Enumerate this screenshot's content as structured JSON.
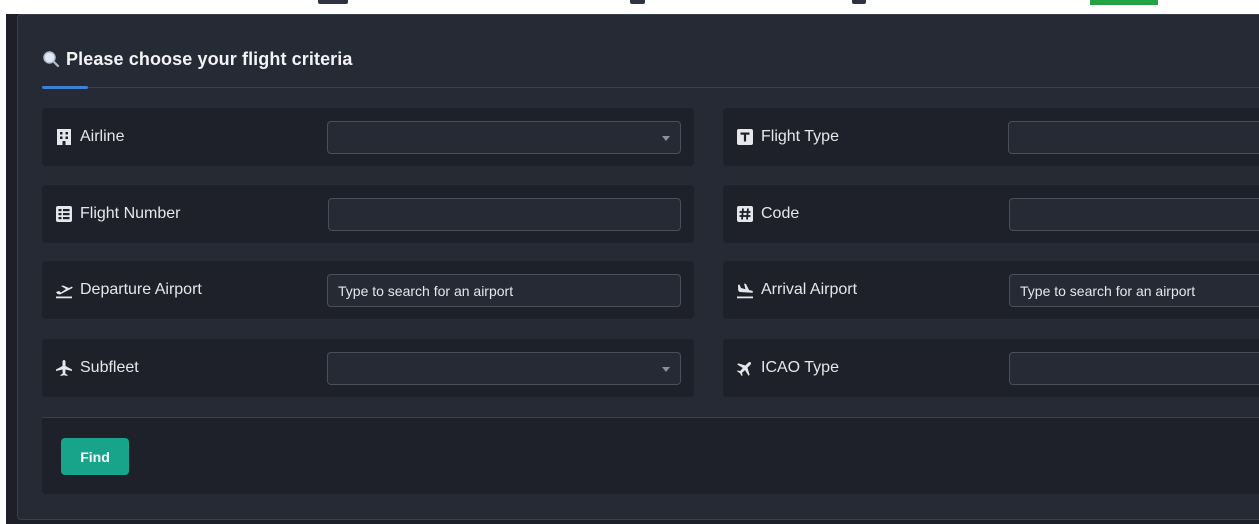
{
  "header": {
    "title": "Please choose your flight criteria",
    "icon": "search-icon"
  },
  "fields": {
    "airline": {
      "label": "Airline",
      "icon": "building-icon",
      "value": ""
    },
    "flight_type": {
      "label": "Flight Type",
      "icon": "type-icon",
      "value": ""
    },
    "flight_number": {
      "label": "Flight Number",
      "icon": "list-icon",
      "value": ""
    },
    "code": {
      "label": "Code",
      "icon": "hash-icon",
      "value": ""
    },
    "departure_airport": {
      "label": "Departure Airport",
      "icon": "plane-departure-icon",
      "placeholder": "Type to search for an airport"
    },
    "arrival_airport": {
      "label": "Arrival Airport",
      "icon": "plane-arrival-icon",
      "placeholder": "Type to search for an airport"
    },
    "subfleet": {
      "label": "Subfleet",
      "icon": "plane-icon",
      "value": ""
    },
    "icao_type": {
      "label": "ICAO Type",
      "icon": "plane-up-icon",
      "value": ""
    }
  },
  "actions": {
    "find_label": "Find"
  },
  "colors": {
    "page_bg": "#1d2029",
    "card_bg": "#262a34",
    "row_bg": "#1e2129",
    "accent": "#3f7fd6",
    "button": "#17a48b"
  }
}
